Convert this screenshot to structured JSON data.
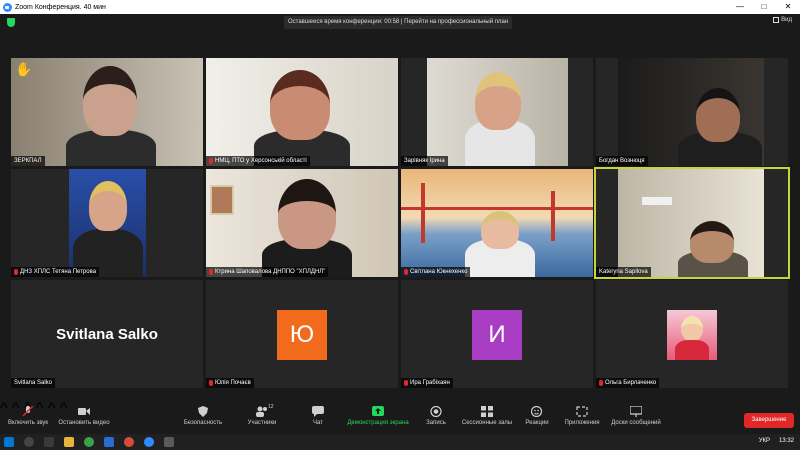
{
  "window": {
    "title": "Zoom Конференция. 40 мин"
  },
  "infobar": {
    "timer_text": "Оставшееся время конференции: 00:58 | Перейти на профессиональный план",
    "view_label": "Вид"
  },
  "participants": [
    {
      "name": "ЗЕРКПАЛ",
      "raised_hand": true,
      "muted": false
    },
    {
      "name": "НМЦ, ПТО у Херсонській області",
      "muted": true
    },
    {
      "name": "Зарівняк Ірина",
      "muted": false
    },
    {
      "name": "Богдан Вознюця",
      "muted": false
    },
    {
      "name": "ДНЗ ХПЛС Тетяна Петрова",
      "muted": true
    },
    {
      "name": "Ктрина Шаповалова ДНППО \"ХПЛДНЛ\"",
      "muted": true
    },
    {
      "name": "Світлана Юкнехенко",
      "muted": true
    },
    {
      "name": "Kateryna Sapilova",
      "muted": false,
      "active": true
    },
    {
      "name": "Svitlana Salko",
      "display_name": "Svitlana Salko",
      "muted": false
    },
    {
      "name": "Юлія Почаєв",
      "avatar_letter": "Ю",
      "avatar_color": "#f26a1b",
      "muted": true
    },
    {
      "name": "Ира Грабіхаян",
      "avatar_letter": "И",
      "avatar_color": "#a83dc4",
      "muted": true
    },
    {
      "name": "Ольга Бирлаченко",
      "muted": true
    }
  ],
  "toolbar": {
    "mute_label": "Включить звук",
    "video_label": "Остановить видео",
    "security_label": "Безопасность",
    "participants_label": "Участники",
    "participants_count": "12",
    "chat_label": "Чат",
    "share_label": "Демонстрация экрана",
    "record_label": "Запись",
    "breakout_label": "Сессионные залы",
    "reactions_label": "Реакции",
    "apps_label": "Приложения",
    "whiteboard_label": "Доски сообщений",
    "end_label": "Завершение"
  },
  "taskbar": {
    "clock": "13:32",
    "lang": "УКР"
  },
  "colors": {
    "accent_green": "#23d959",
    "end_red": "#e02828",
    "active_border": "#c8d53a"
  }
}
